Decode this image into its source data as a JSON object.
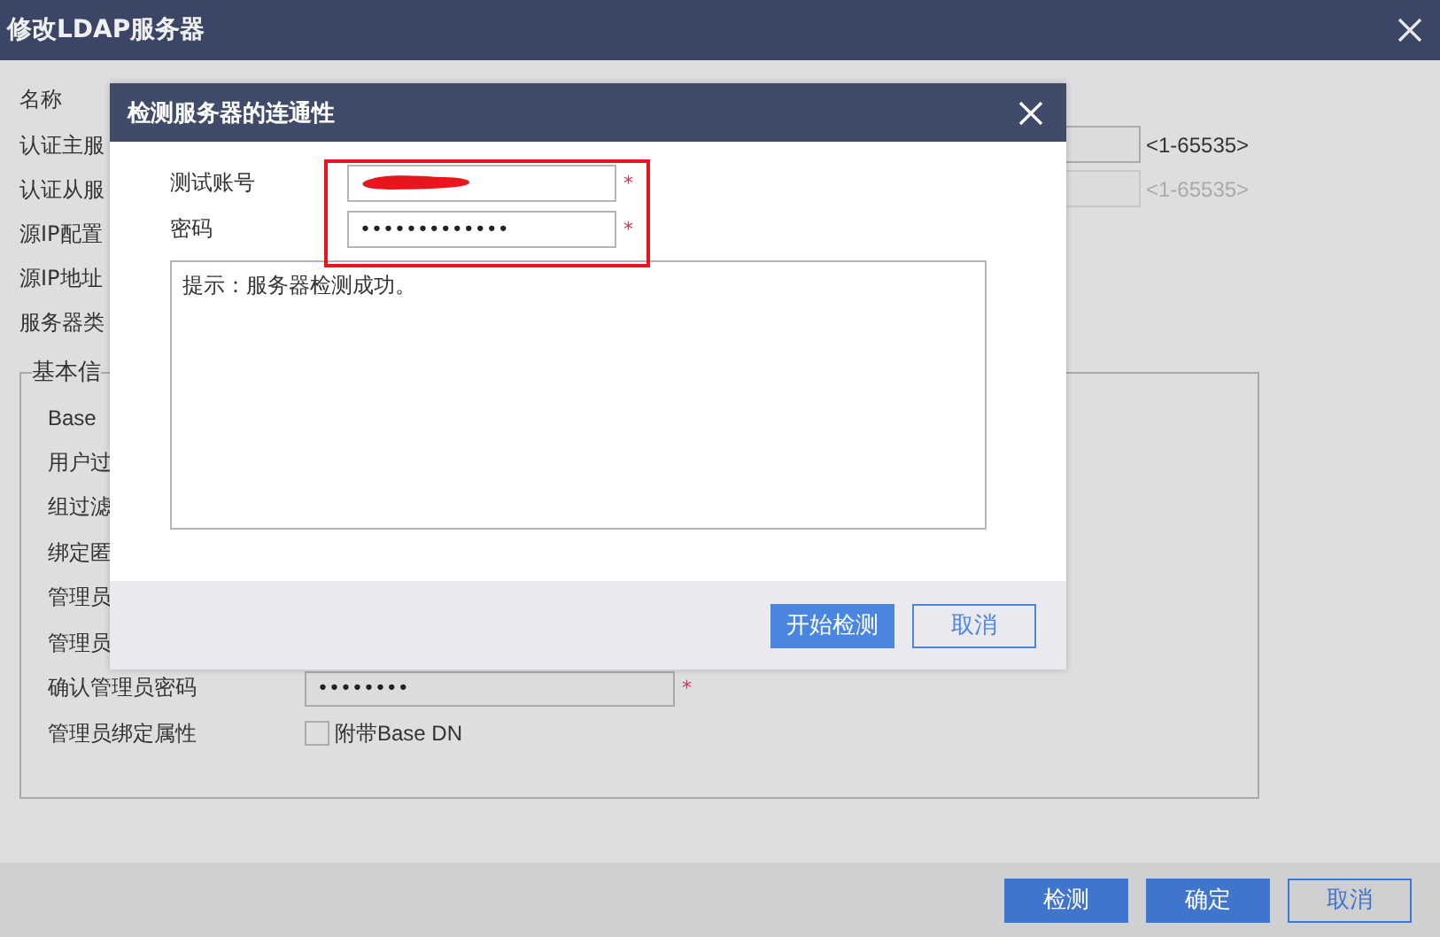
{
  "window": {
    "title": "修改LDAP服务器"
  },
  "form": {
    "rows": [
      {
        "label": "名称"
      },
      {
        "label": "认证主服",
        "port_hint": "<1-65535>",
        "port_disabled": false
      },
      {
        "label": "认证从服",
        "port_hint": "<1-65535>",
        "port_disabled": true
      },
      {
        "label": "源IP配置"
      },
      {
        "label": "源IP地址"
      },
      {
        "label": "服务器类"
      }
    ]
  },
  "basic_info": {
    "legend": "基本信",
    "rows": [
      {
        "label": "Base",
        "kind": "plain"
      },
      {
        "label": "用户过",
        "kind": "plain"
      },
      {
        "label": "组过滤",
        "kind": "plain"
      },
      {
        "label": "绑定匿",
        "kind": "plain"
      },
      {
        "label": "管理员",
        "kind": "plain"
      },
      {
        "label": "管理员",
        "kind": "plain"
      },
      {
        "label": "确认管理员密码",
        "kind": "password",
        "value": "••••••••",
        "required_mark": "*"
      },
      {
        "label": "管理员绑定属性",
        "kind": "checkbox",
        "checked": false,
        "option": "附带Base DN"
      }
    ]
  },
  "footer_buttons": [
    {
      "label": "检测",
      "kind": "primary"
    },
    {
      "label": "确定",
      "kind": "primary"
    },
    {
      "label": "取消",
      "kind": "outline"
    }
  ],
  "modal": {
    "title": "检测服务器的连通性",
    "fields": [
      {
        "label": "测试账号",
        "kind": "redacted",
        "required_mark": "*"
      },
      {
        "label": "密码",
        "kind": "password",
        "value": "•••••••••••••",
        "required_mark": "*"
      }
    ],
    "message": "提示：服务器检测成功。",
    "buttons": [
      {
        "label": "开始检测",
        "kind": "primary"
      },
      {
        "label": "取消",
        "kind": "outline"
      }
    ]
  }
}
